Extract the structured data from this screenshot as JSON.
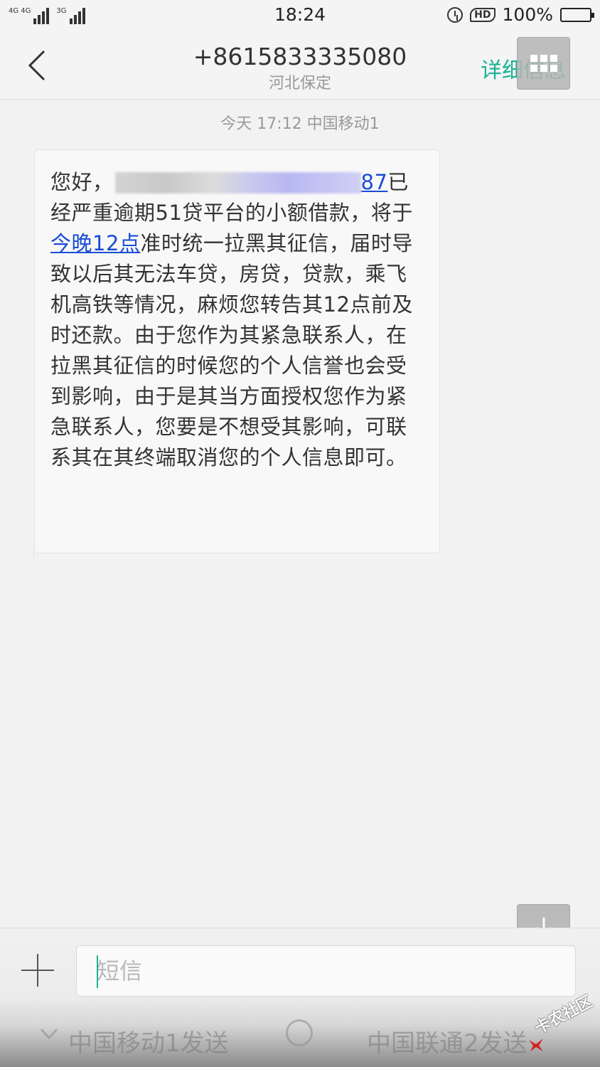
{
  "status_bar": {
    "network_labels": [
      "4G 4G",
      "3G"
    ],
    "time": "18:24",
    "hd_label": "HD",
    "battery_text": "100%"
  },
  "header": {
    "phone_number": "+8615833335080",
    "location": "河北保定",
    "details_label": "详细信息"
  },
  "conversation": {
    "timestamp": "今天 17:12 中国移动1",
    "message": {
      "part1": "您好，",
      "digits": "87",
      "part2": "已经严重逾期51贷平台的小额借款，将于",
      "link": "今晚12点",
      "part3": "准时统一拉黑其征信，届时导致以后其无法车贷，房贷，贷款，乘飞机高铁等情况，麻烦您转告其12点前及时还款。由于您作为其紧急联系人，在拉黑其征信的时候您的个人信誉也会受到影响，由于是其当方面授权您作为紧急联系人，您要是不想受其影响，可联系其在其终端取消您的个人信息即可。"
    }
  },
  "compose": {
    "placeholder": "短信",
    "send_sim1": "中国移动1发送",
    "send_sim2": "中国联通2发送"
  },
  "watermark": {
    "text": "卡农社区"
  },
  "colors": {
    "accent": "#1ab394",
    "link": "#1a4dd6",
    "background": "#f2f2f2"
  }
}
